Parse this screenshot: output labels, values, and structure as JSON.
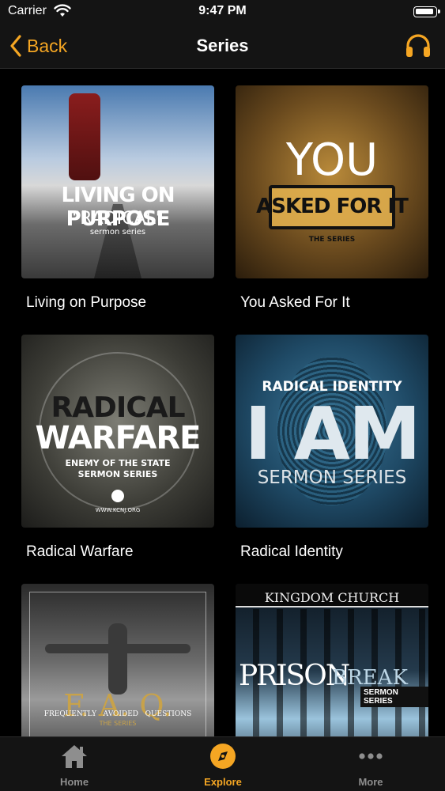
{
  "status_bar": {
    "carrier": "Carrier",
    "time": "9:47 PM"
  },
  "nav": {
    "back_label": "Back",
    "title": "Series"
  },
  "series": [
    {
      "title": "Living on Purpose",
      "art": {
        "line1": "LIVING ON PURPOSE",
        "line2": "\"RADICAL\"",
        "line3": "sermon series"
      }
    },
    {
      "title": "You Asked For It",
      "art": {
        "line1": "YOU",
        "line2": "ASKED FOR IT",
        "line3": "THE SERIES"
      }
    },
    {
      "title": "Radical Warfare",
      "art": {
        "line1": "RADICAL",
        "line2": "WARFARE",
        "line3": "ENEMY OF THE STATE",
        "line4": "SERMON SERIES",
        "line5": "WWW.KCNJ.ORG"
      }
    },
    {
      "title": "Radical Identity",
      "art": {
        "line1": "RADICAL IDENTITY",
        "line2": "I AM",
        "line3": "SERMON SERIES"
      }
    },
    {
      "title": "",
      "art": {
        "line1": "F. A. Q.",
        "line2": "FREQUENTLY   AVOIDED   QUESTIONS",
        "line3": "THE SERIES"
      }
    },
    {
      "title": "",
      "art": {
        "line1": "KINGDOM CHURCH",
        "line2": "PRISON",
        "line3": "BREAK",
        "line4": "SERMON SERIES"
      }
    }
  ],
  "tabs": [
    {
      "label": "Home",
      "icon": "home-icon",
      "active": false
    },
    {
      "label": "Explore",
      "icon": "compass-icon",
      "active": true
    },
    {
      "label": "More",
      "icon": "more-icon",
      "active": false
    }
  ],
  "colors": {
    "accent": "#f5a623",
    "background": "#000000",
    "bar": "#141414",
    "inactive": "#8e8e8e"
  }
}
